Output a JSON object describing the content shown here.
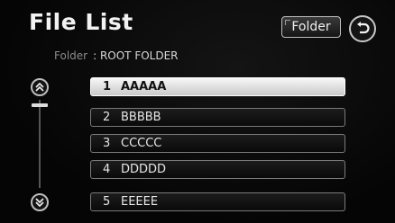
{
  "screen": {
    "title": "File List"
  },
  "header": {
    "folder_button_label": "Folder",
    "back_icon": "back-arrow-icon"
  },
  "folder_info": {
    "label": "Folder",
    "value": ": ROOT FOLDER"
  },
  "scrollbar": {
    "up_icon": "double-chevron-up-icon",
    "down_icon": "double-chevron-down-icon",
    "position": 0.0
  },
  "files": [
    {
      "number": "1",
      "name": "AAAAA",
      "selected": true
    },
    {
      "number": "2",
      "name": "BBBBB",
      "selected": false
    },
    {
      "number": "3",
      "name": "CCCCC",
      "selected": false
    },
    {
      "number": "4",
      "name": "DDDDD",
      "selected": false
    },
    {
      "number": "5",
      "name": "EEEEE",
      "selected": false
    }
  ]
}
